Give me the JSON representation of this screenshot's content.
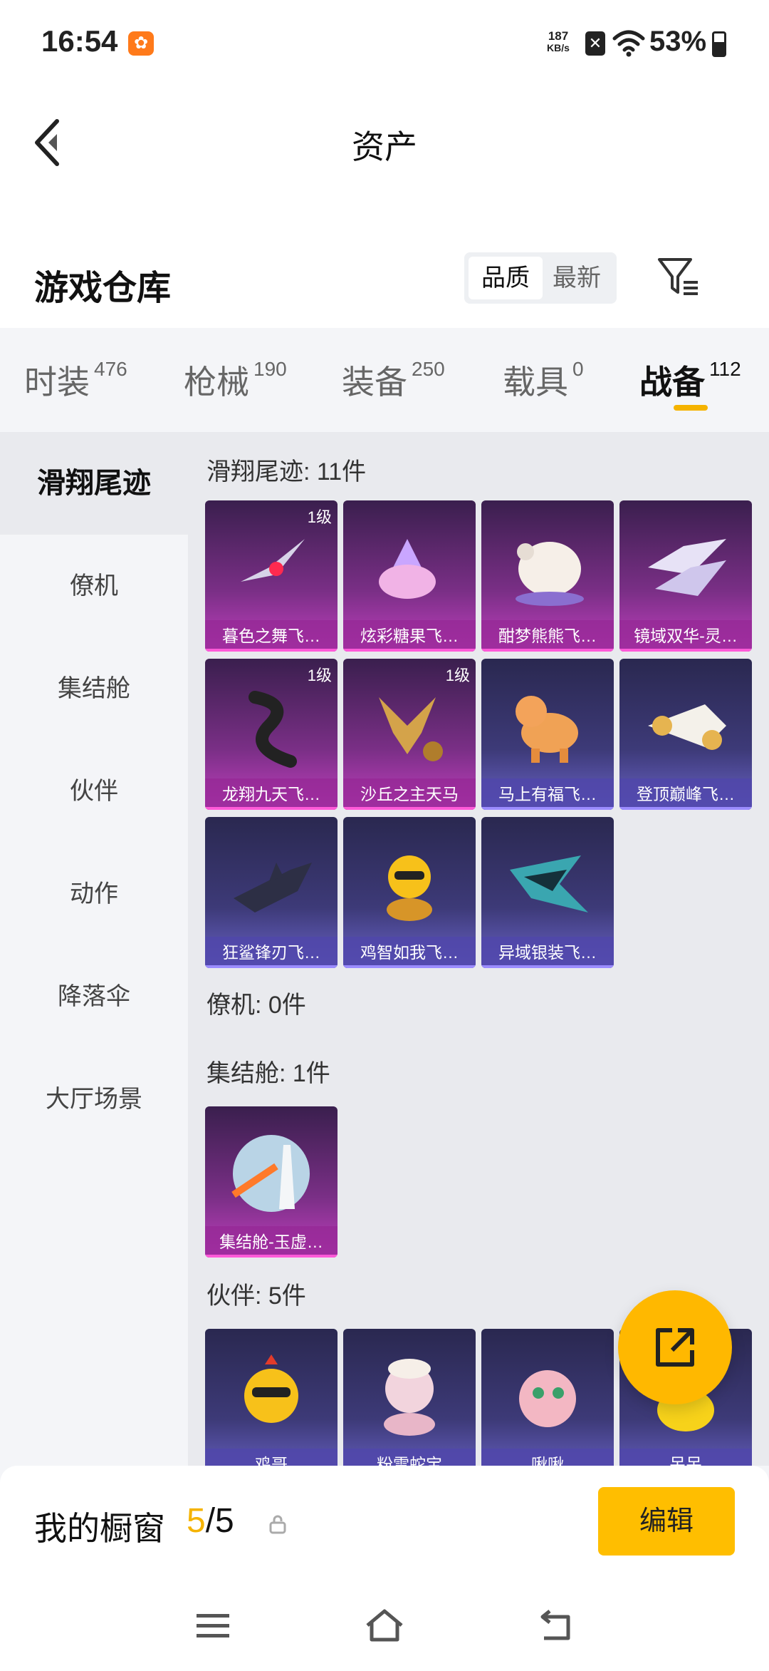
{
  "status_bar": {
    "time": "16:54",
    "net_speed_value": "187",
    "net_speed_unit": "KB/s",
    "battery": "53%",
    "icons": [
      "app-notification-icon",
      "no-sim-icon",
      "wifi-icon",
      "battery-icon"
    ]
  },
  "header": {
    "title": "资产",
    "back_icon": "chevron-left-icon"
  },
  "warehouse": {
    "title": "游戏仓库",
    "sort_options": [
      "品质",
      "最新"
    ],
    "sort_selected": "品质",
    "filter_icon": "filter-icon"
  },
  "tabs": [
    {
      "label": "时装",
      "count": "476"
    },
    {
      "label": "枪械",
      "count": "190"
    },
    {
      "label": "装备",
      "count": "250"
    },
    {
      "label": "载具",
      "count": "0"
    },
    {
      "label": "战备",
      "count": "112",
      "active": true
    }
  ],
  "sidebar": {
    "items": [
      "滑翔尾迹",
      "僚机",
      "集结舱",
      "伙伴",
      "动作",
      "降落伞",
      "大厅场景"
    ],
    "active": "滑翔尾迹"
  },
  "sections": [
    {
      "title": "滑翔尾迹: 11件",
      "items": [
        {
          "name": "暮色之舞飞…",
          "level": "1级",
          "quality": "pink"
        },
        {
          "name": "炫彩糖果飞…",
          "quality": "pink"
        },
        {
          "name": "酣梦熊熊飞…",
          "quality": "pink"
        },
        {
          "name": "镜域双华-灵…",
          "quality": "pink"
        },
        {
          "name": "龙翔九天飞…",
          "level": "1级",
          "quality": "pink"
        },
        {
          "name": "沙丘之主天马",
          "level": "1级",
          "quality": "pink"
        },
        {
          "name": "马上有福飞…",
          "quality": "purple"
        },
        {
          "name": "登顶巅峰飞…",
          "quality": "purple"
        },
        {
          "name": "狂鲨锋刃飞…",
          "quality": "purple"
        },
        {
          "name": "鸡智如我飞…",
          "quality": "purple"
        },
        {
          "name": "异域银装飞…",
          "quality": "purple"
        }
      ]
    },
    {
      "title": "僚机: 0件",
      "items": []
    },
    {
      "title": "集结舱: 1件",
      "items": [
        {
          "name": "集结舱-玉虚…",
          "quality": "pink"
        }
      ]
    },
    {
      "title": "伙伴: 5件",
      "items": [
        {
          "name": "鸡哥",
          "quality": "purple"
        },
        {
          "name": "粉雪蛇宝",
          "quality": "purple"
        },
        {
          "name": "啾啾",
          "quality": "purple"
        },
        {
          "name": "呆呆",
          "quality": "purple"
        }
      ]
    }
  ],
  "showcase": {
    "title": "我的橱窗",
    "current": "5",
    "separator": "/",
    "max": "5",
    "edit_label": "编辑"
  },
  "fab": {
    "icon": "share-external-icon"
  },
  "nav": {
    "icons": [
      "menu-icon",
      "home-icon",
      "back-icon"
    ]
  },
  "colors": {
    "accent": "#ffbe00",
    "quality_pink": "#c13fbe",
    "quality_purple": "#6a63c8"
  }
}
